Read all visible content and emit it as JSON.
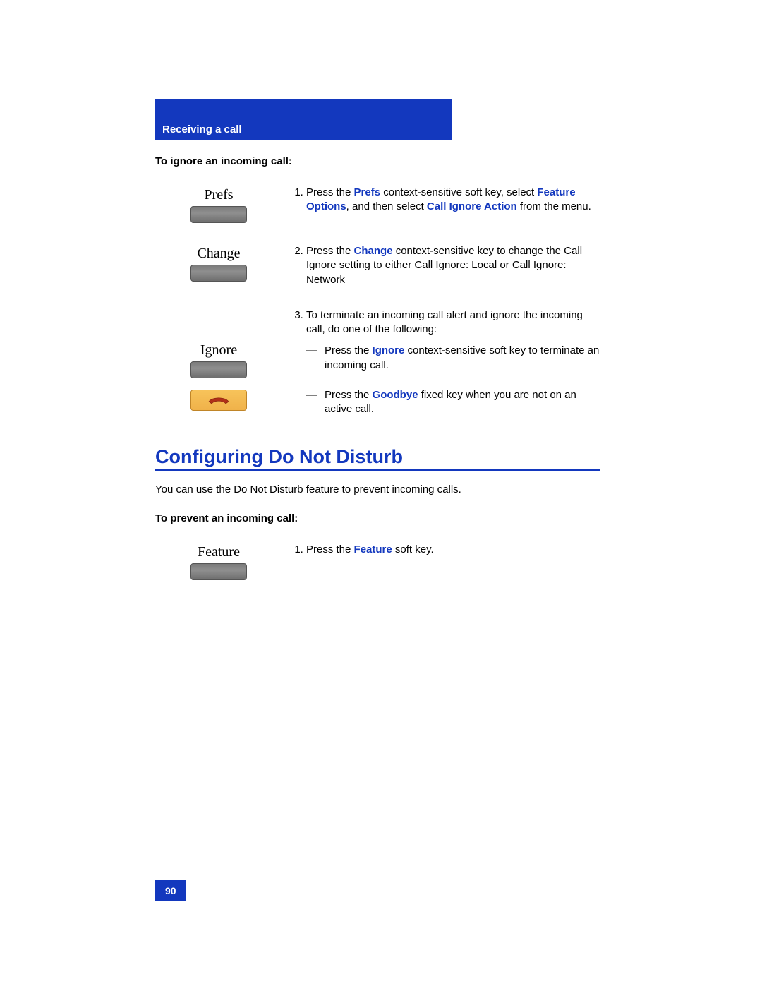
{
  "header": {
    "title": "Receiving a call"
  },
  "section1": {
    "heading": "To ignore an incoming call:",
    "steps": [
      {
        "key_label": "Prefs",
        "num": "1.",
        "text_pre": "Press the ",
        "blue1": "Prefs",
        "text_mid1": " context-sensitive soft key, select ",
        "blue2": "Feature Options",
        "text_mid2": ", and then select ",
        "blue3": "Call Ignore Action",
        "text_post": " from the menu."
      },
      {
        "key_label": "Change",
        "num": "2.",
        "text_pre": "Press the ",
        "blue1": "Change",
        "text_post": " context-sensitive key to change the Call Ignore setting to either Call Ignore: Local or Call Ignore: Network"
      },
      {
        "key_label": "Ignore",
        "num": "3.",
        "intro": "To terminate an incoming call alert and ignore the incoming call, do one of the following:",
        "sub1_pre": "Press the ",
        "sub1_blue": "Ignore",
        "sub1_post": " context-sensitive soft key to terminate an incoming call.",
        "sub2_pre": "Press the ",
        "sub2_blue": "Goodbye",
        "sub2_post": " fixed key when you are not on an active call."
      }
    ]
  },
  "section2": {
    "title": "Configuring Do Not Disturb",
    "intro": "You can use the Do Not Disturb feature to prevent incoming calls.",
    "heading": "To prevent an incoming call:",
    "step": {
      "key_label": "Feature",
      "num": "1.",
      "text_pre": "Press the ",
      "blue1": "Feature",
      "text_post": " soft key."
    }
  },
  "page_number": "90"
}
